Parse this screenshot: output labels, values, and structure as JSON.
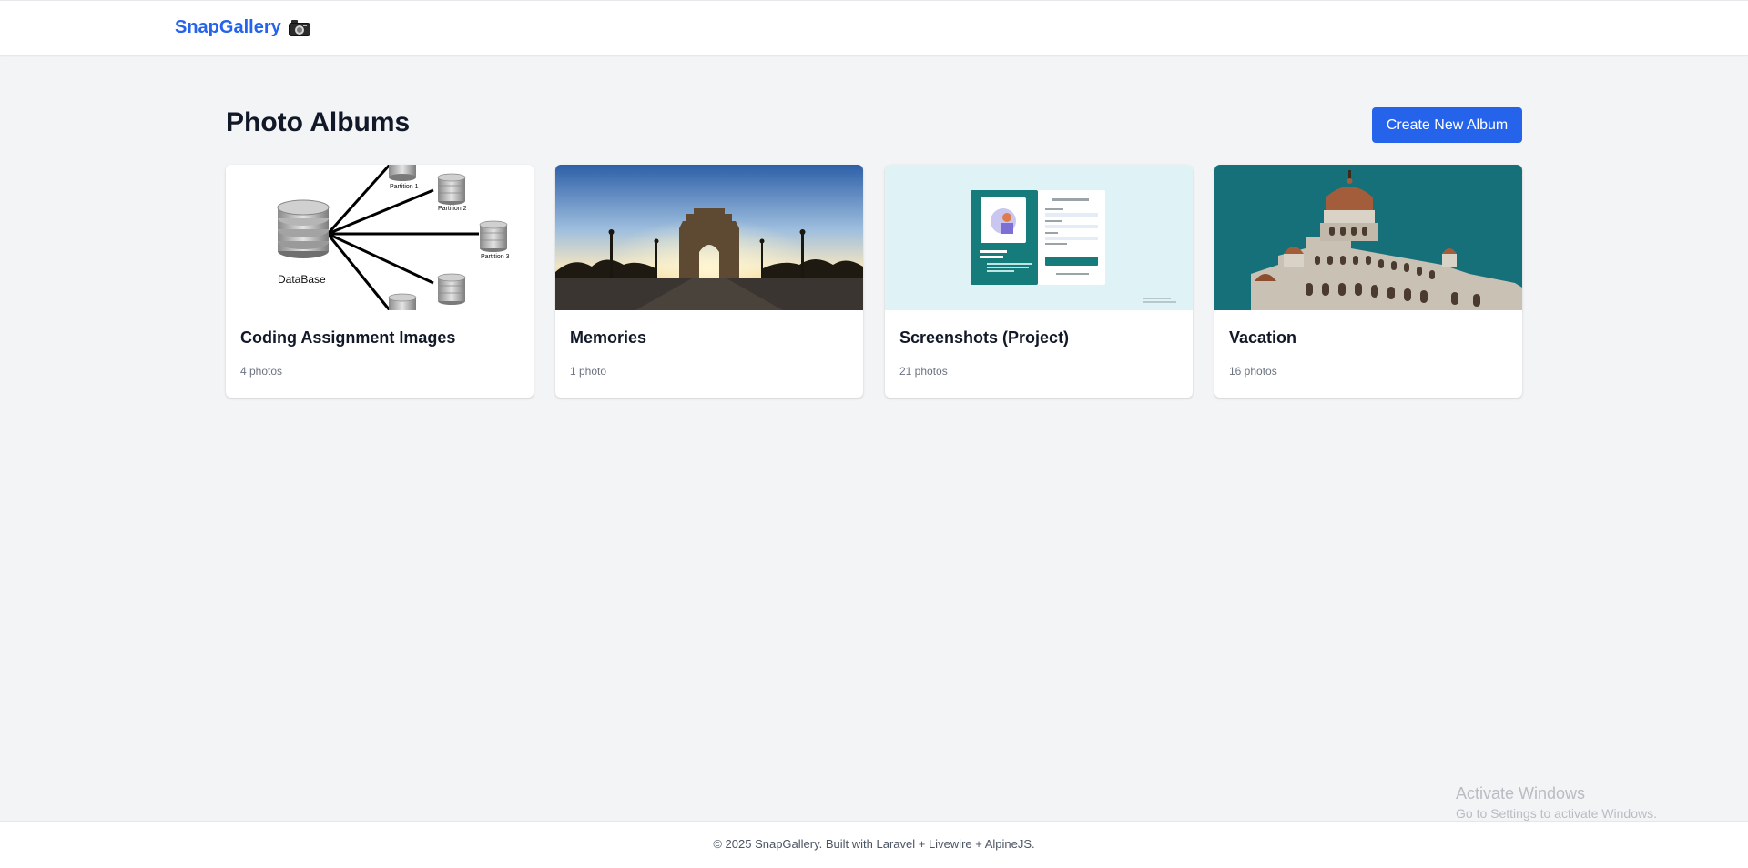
{
  "app": {
    "brand": "SnapGallery",
    "brand_icon": "camera-icon"
  },
  "page": {
    "title": "Photo Albums",
    "create_button": "Create New Album"
  },
  "albums": [
    {
      "title": "Coding Assignment Images",
      "count": "4 photos",
      "thumb": {
        "kind": "database-diagram",
        "labels": [
          "DataBase",
          "Partition 1",
          "Partition 2",
          "Partition 3"
        ]
      }
    },
    {
      "title": "Memories",
      "count": "1 photo",
      "thumb": {
        "kind": "india-gate-sunset"
      }
    },
    {
      "title": "Screenshots (Project)",
      "count": "21 photos",
      "thumb": {
        "kind": "app-login-screenshot"
      }
    },
    {
      "title": "Vacation",
      "count": "16 photos",
      "thumb": {
        "kind": "palace-dome"
      }
    }
  ],
  "footer": {
    "text": "© 2025 SnapGallery. Built with Laravel + Livewire + AlpineJS."
  },
  "os_watermark": {
    "line1": "Activate Windows",
    "line2": "Go to Settings to activate Windows."
  },
  "colors": {
    "accent": "#2563eb",
    "background": "#f3f4f6",
    "card": "#ffffff",
    "muted": "#6b7280"
  }
}
